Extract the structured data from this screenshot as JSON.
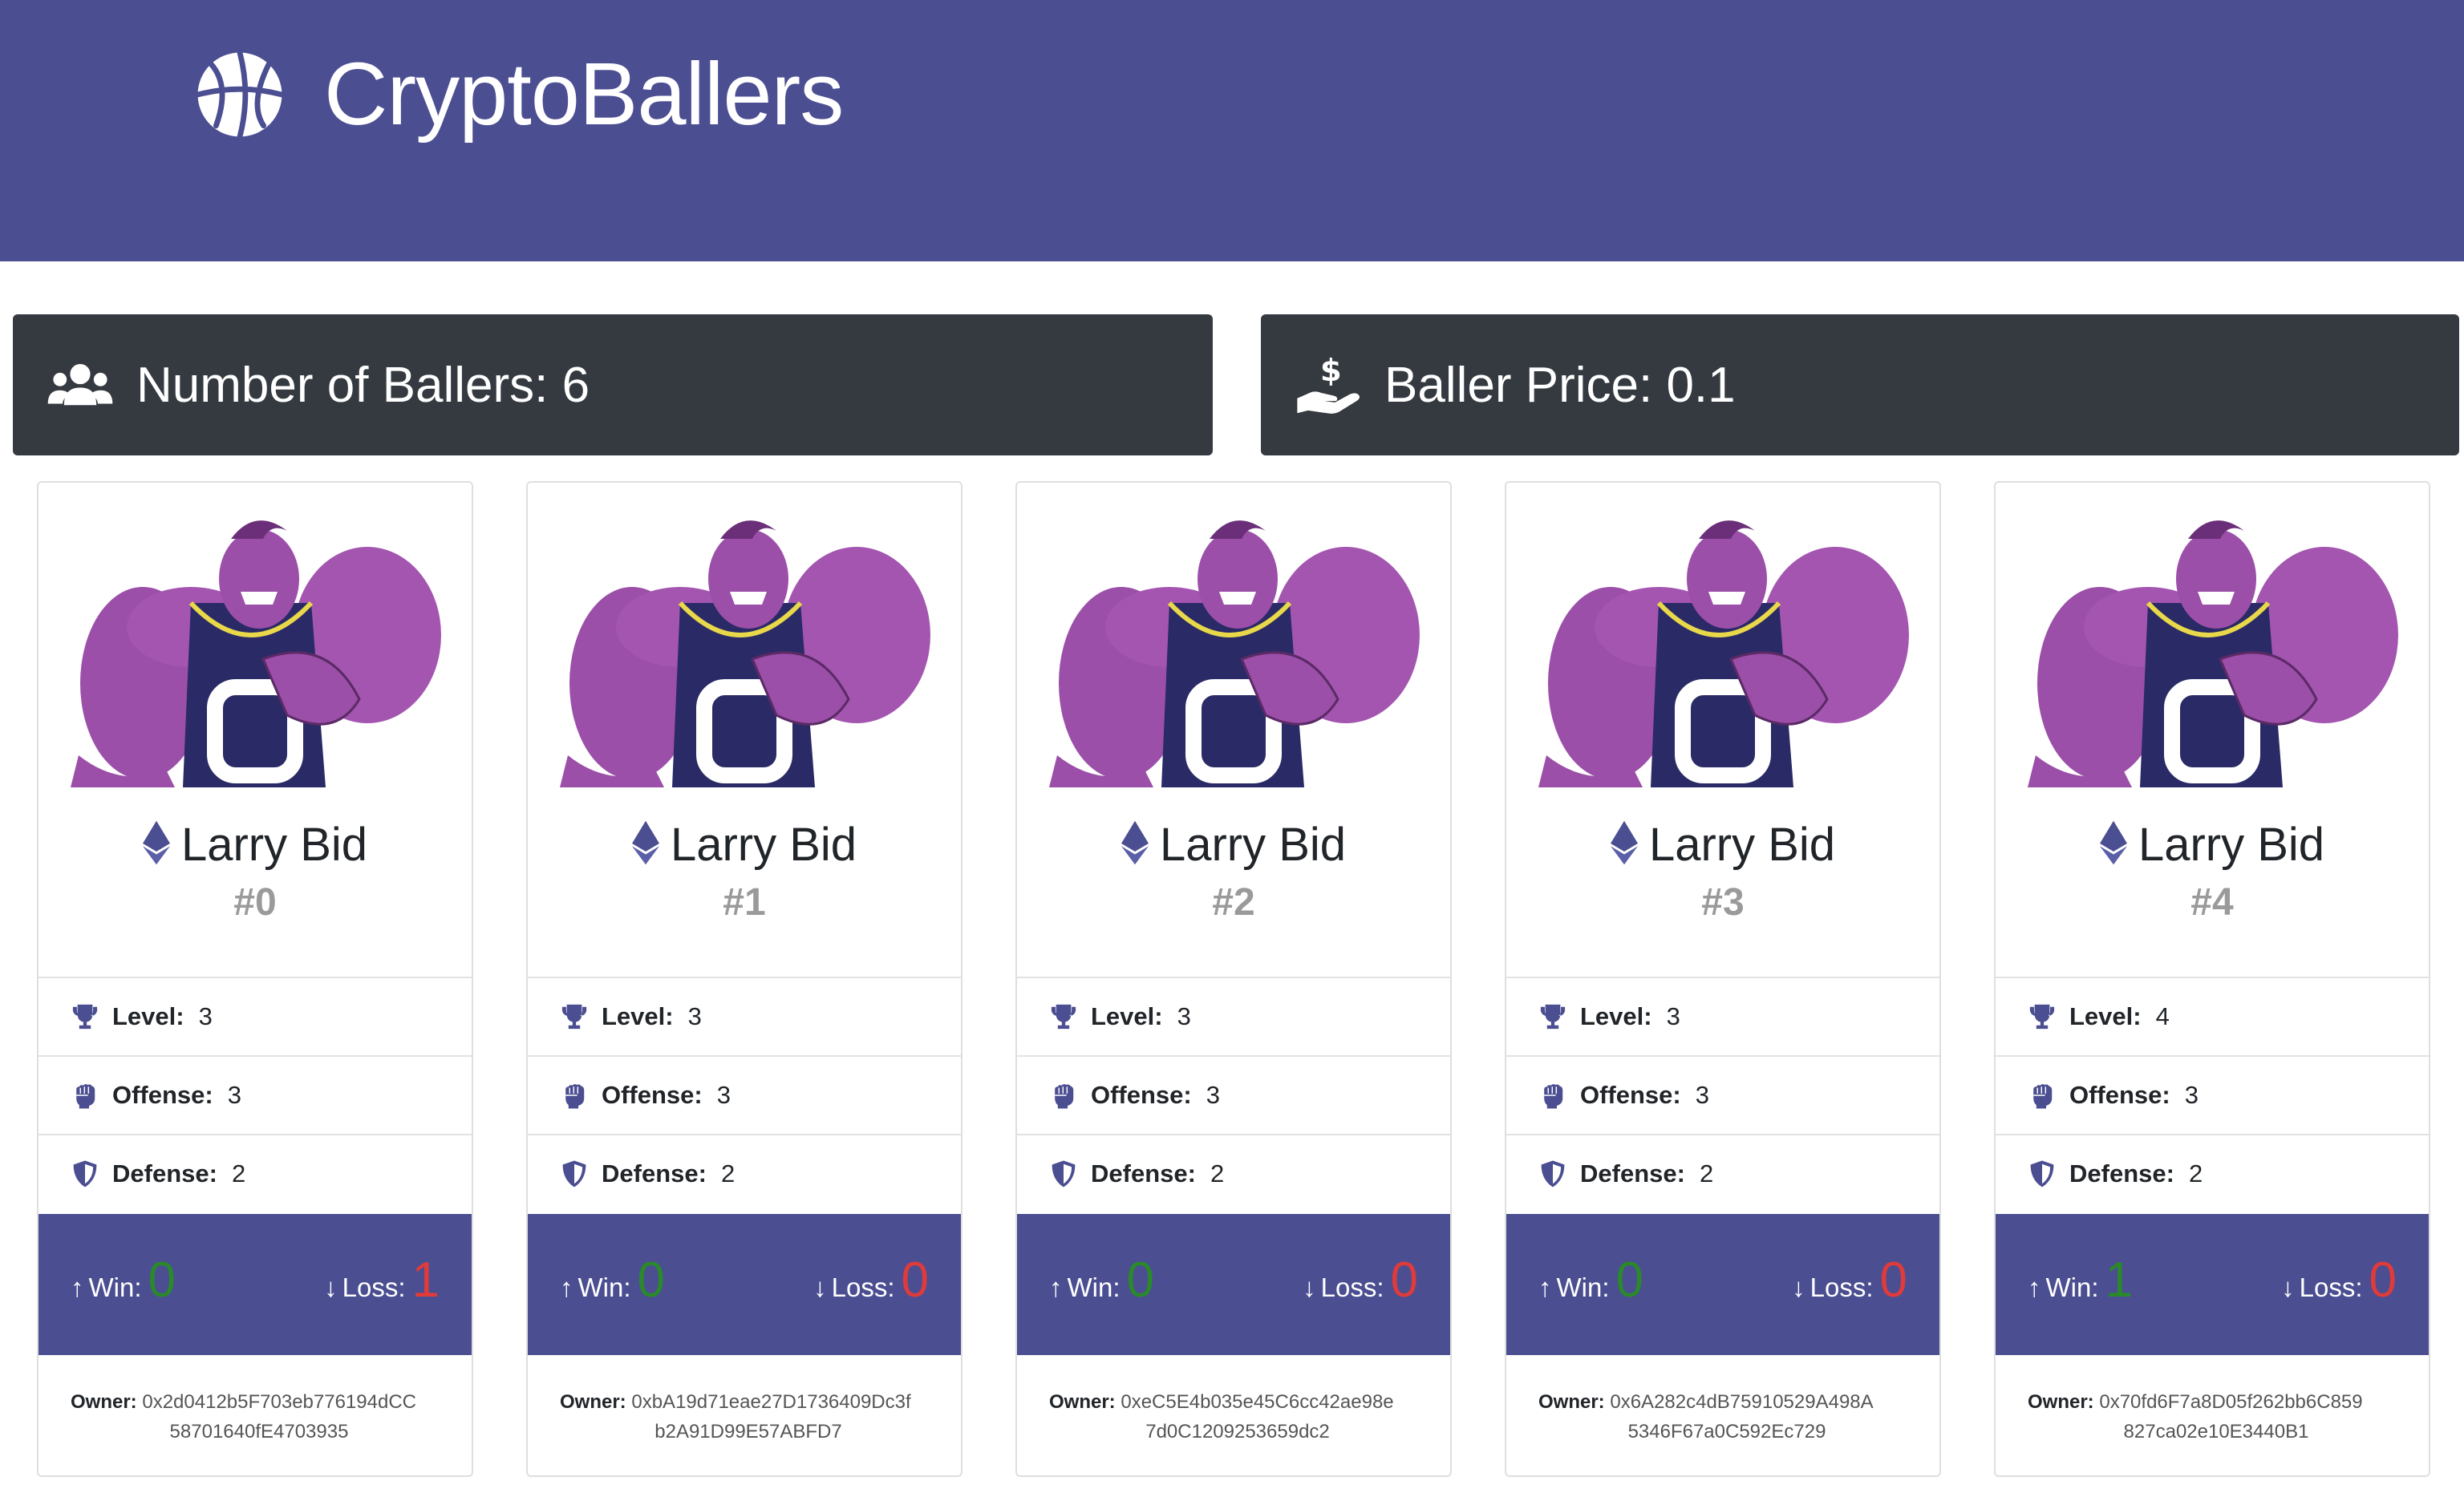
{
  "header": {
    "title": "CryptoBallers"
  },
  "stats": {
    "ballers": "Number of Ballers: 6",
    "price": "Baller Price: 0.1"
  },
  "colors": {
    "brand": "#4b4e91",
    "dark": "#343a40",
    "win": "#2a8a2a",
    "loss": "#e03b3b"
  },
  "labels": {
    "level": "Level:",
    "offense": "Offense:",
    "defense": "Defense:",
    "win": "Win:",
    "loss": "Loss:",
    "owner": "Owner:"
  },
  "cards": [
    {
      "name": "Larry Bid",
      "id": "#0",
      "level": "3",
      "offense": "3",
      "defense": "2",
      "win": "0",
      "loss": "1",
      "owner_line1": "0x2d0412b5F703eb776194dCC",
      "owner_line2": "58701640fE4703935"
    },
    {
      "name": "Larry Bid",
      "id": "#1",
      "level": "3",
      "offense": "3",
      "defense": "2",
      "win": "0",
      "loss": "0",
      "owner_line1": "0xbA19d71eae27D1736409Dc3f",
      "owner_line2": "b2A91D99E57ABFD7"
    },
    {
      "name": "Larry Bid",
      "id": "#2",
      "level": "3",
      "offense": "3",
      "defense": "2",
      "win": "0",
      "loss": "0",
      "owner_line1": "0xeC5E4b035e45C6cc42ae98e",
      "owner_line2": "7d0C1209253659dc2"
    },
    {
      "name": "Larry Bid",
      "id": "#3",
      "level": "3",
      "offense": "3",
      "defense": "2",
      "win": "0",
      "loss": "0",
      "owner_line1": "0x6A282c4dB75910529A498A",
      "owner_line2": "5346F67a0C592Ec729"
    },
    {
      "name": "Larry Bid",
      "id": "#4",
      "level": "4",
      "offense": "3",
      "defense": "2",
      "win": "1",
      "loss": "0",
      "owner_line1": "0x70fd6F7a8D05f262bb6C859",
      "owner_line2": "827ca02e10E3440B1"
    }
  ]
}
